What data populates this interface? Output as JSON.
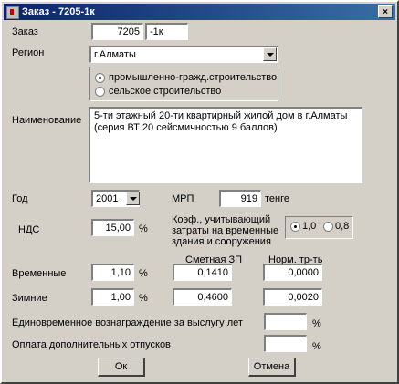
{
  "window": {
    "title": "Заказ - 7205-1к",
    "close": "×"
  },
  "order": {
    "label": "Заказ",
    "number": "7205",
    "suffix": "-1к"
  },
  "region": {
    "label": "Регион",
    "value": "г.Алматы"
  },
  "construction_type": {
    "options": [
      {
        "label": "промышленно-гражд.строительство",
        "selected": true
      },
      {
        "label": "сельское строительство",
        "selected": false
      }
    ]
  },
  "name": {
    "label": "Наименование",
    "value": "5-ти этажный 20-ти квартирный жилой дом в г.Алматы (серия ВТ 20 сейсмичностью 9 баллов)"
  },
  "year": {
    "label": "Год",
    "value": "2001"
  },
  "mrp": {
    "label": "МРП",
    "value": "919",
    "unit": "тенге"
  },
  "nds": {
    "label": "НДС",
    "value": "15,00",
    "unit": "%"
  },
  "coef": {
    "label": "Коэф., учитывающий затраты на временные здания и сооружения",
    "options": [
      {
        "label": "1,0",
        "selected": true
      },
      {
        "label": "0,8",
        "selected": false
      }
    ]
  },
  "columns": {
    "estimate": "Сметная ЗП",
    "norm": "Норм. тр-ть"
  },
  "temporary": {
    "label": "Временные",
    "percent": "1,10",
    "unit": "%",
    "estimate": "0,1410",
    "norm": "0,0000"
  },
  "winter": {
    "label": "Зимние",
    "percent": "1,00",
    "unit": "%",
    "estimate": "0,4600",
    "norm": "0,0020"
  },
  "seniority": {
    "label": "Единовременное вознаграждение за выслугу лет",
    "value": "",
    "unit": "%"
  },
  "vacation": {
    "label": "Оплата дополнительных отпусков",
    "value": "",
    "unit": "%"
  },
  "buttons": {
    "ok": "Ок",
    "cancel": "Отмена"
  }
}
